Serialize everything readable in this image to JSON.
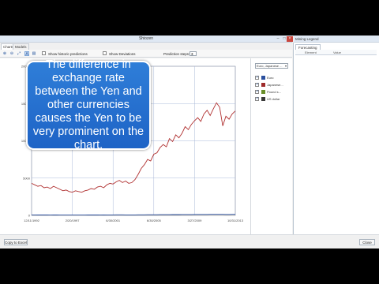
{
  "window": {
    "title": "Shiozen"
  },
  "tabs": [
    {
      "label": "Charts"
    },
    {
      "label": "Models"
    }
  ],
  "toolbar": {
    "show_historic": "Show historic predictions",
    "show_deviations": "Show Deviations",
    "prediction_steps_label": "Prediction steps:",
    "prediction_steps_value": "3"
  },
  "legend": {
    "select_value": "Euro, Japanese ...",
    "items": [
      {
        "name": "Euro",
        "color": "#2a4f9e",
        "checked": true
      },
      {
        "name": "Japanese...",
        "color": "#9e2a2a",
        "checked": true
      },
      {
        "name": "Pound s...",
        "color": "#6a8f2a",
        "checked": true
      },
      {
        "name": "US dollar",
        "color": "#3a3a3a",
        "checked": true
      }
    ]
  },
  "right_panel": {
    "title": "Mining Legend",
    "tab": "Forecasting",
    "col_element": "Element",
    "col_value": "Value"
  },
  "bottom": {
    "copy_button": "Copy to Excel",
    "close_button": "Close"
  },
  "callout": {
    "text": "The difference in exchange rate between the Yen and other currencies causes the Yen to be very prominent on the chart."
  },
  "chart_data": {
    "type": "line",
    "x_ticks": [
      "12/11/1992",
      "2/20/1997",
      "6/30/2001",
      "6/30/2005",
      "3/27/2009",
      "10/31/2013"
    ],
    "y_ticks": [
      "0",
      "5000",
      "10000",
      "15000",
      "20000"
    ],
    "ylim": [
      0,
      20000
    ],
    "series": [
      {
        "name": "Japanese...",
        "color": "#b03030",
        "values": [
          4300,
          4100,
          3900,
          4000,
          3700,
          3800,
          3600,
          3900,
          3700,
          3500,
          3300,
          3400,
          3200,
          3100,
          3300,
          3200,
          3100,
          3300,
          3400,
          3600,
          3500,
          3800,
          3900,
          3700,
          4100,
          4300,
          4200,
          4500,
          4700,
          4400,
          4600,
          4300,
          4400,
          4800,
          5500,
          6300,
          6800,
          7500,
          7300,
          8200,
          8400,
          9100,
          9500,
          9200,
          10300,
          9900,
          10800,
          10400,
          11000,
          11900,
          11500,
          12200,
          12700,
          13100,
          12600,
          13600,
          14100,
          13400,
          14300,
          15100,
          14500,
          12000,
          13300,
          12900,
          13600,
          14000
        ]
      },
      {
        "name": "Euro",
        "color": "#2a4f9e",
        "values": [
          60,
          60,
          55,
          55,
          50,
          50,
          45,
          50,
          48,
          45,
          40,
          40,
          42,
          40,
          38,
          40,
          42,
          45,
          48,
          50,
          52,
          55,
          60,
          58,
          62,
          65,
          68,
          70,
          72,
          70,
          68,
          66,
          64,
          66,
          70,
          75,
          78,
          80,
          82,
          84,
          86,
          90,
          92,
          95,
          100,
          104,
          108,
          110,
          112,
          115,
          118,
          120,
          122,
          124,
          126,
          130,
          132,
          134,
          136,
          138,
          140,
          135,
          130,
          132,
          134,
          136
        ]
      }
    ]
  }
}
